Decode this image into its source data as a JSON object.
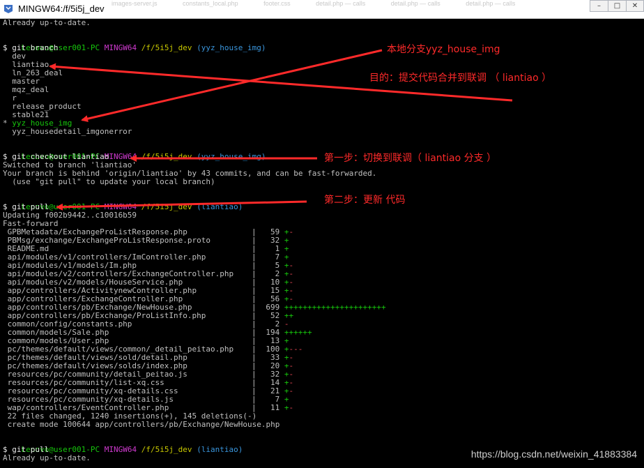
{
  "window": {
    "title": "MINGW64:/f/5i5j_dev",
    "ghost_tabs": [
      "images-server.js",
      "constants_local.php",
      "footer.css",
      "detail.php — calls",
      "detail.php — calls",
      "detail.php — calls"
    ]
  },
  "prompt": {
    "user": "Lenovo@user001-PC",
    "shell": "MINGW64",
    "path": "/f/5i5j_dev"
  },
  "terminal": {
    "line01": "Already up-to-date.",
    "prompt1_branch": "(yyz_house_img)",
    "cmd1": "$ git branch",
    "branches": [
      "  dev",
      "  liantiao",
      "  ln_263_deal",
      "  master",
      "  mqz_deal",
      "  r",
      "  release_product",
      "  stable21"
    ],
    "current_branch_mark": "* ",
    "current_branch": "yyz_house_img",
    "branch_last": "  yyz_housedetail_imgonerror",
    "prompt2_branch": "(yyz_house_img)",
    "cmd2": "$ git checkout liantiao",
    "switched": "Switched to branch 'liantiao'",
    "behind": "Your branch is behind 'origin/liantiao' by 43 commits, and can be fast-forwarded.",
    "hint": "  (use \"git pull\" to update your local branch)",
    "prompt3_branch": "(liantiao)",
    "cmd3": "$ git pull",
    "updating": "Updating f002b9442..c10016b59",
    "fastforward": "Fast-forward",
    "files": [
      {
        "name": " GPBMetadata/ExchangeProListResponse.php",
        "count": "59",
        "plus": "+",
        "minus": "-"
      },
      {
        "name": " PBMsg/exchange/ExchangeProListResponse.proto",
        "count": "32",
        "plus": "+",
        "minus": ""
      },
      {
        "name": " README.md",
        "count": "1",
        "plus": "+",
        "minus": ""
      },
      {
        "name": " api/modules/v1/controllers/ImController.php",
        "count": "7",
        "plus": "+",
        "minus": ""
      },
      {
        "name": " api/modules/v1/models/Im.php",
        "count": "5",
        "plus": "+",
        "minus": "-"
      },
      {
        "name": " api/modules/v2/controllers/ExchangeController.php",
        "count": "2",
        "plus": "+",
        "minus": "-"
      },
      {
        "name": " api/modules/v2/models/HouseService.php",
        "count": "10",
        "plus": "+",
        "minus": "-"
      },
      {
        "name": " app/controllers/ActivitynewController.php",
        "count": "15",
        "plus": "+",
        "minus": "-"
      },
      {
        "name": " app/controllers/ExchangeController.php",
        "count": "56",
        "plus": "+",
        "minus": "-"
      },
      {
        "name": " app/controllers/pb/Exchange/NewHouse.php",
        "count": "699",
        "plus": "++++++++++++++++++++++",
        "minus": ""
      },
      {
        "name": " app/controllers/pb/Exchange/ProListInfo.php",
        "count": "52",
        "plus": "++",
        "minus": ""
      },
      {
        "name": " common/config/constants.php",
        "count": "2",
        "plus": "",
        "minus": "-"
      },
      {
        "name": " common/models/Sale.php",
        "count": "194",
        "plus": "++++++",
        "minus": ""
      },
      {
        "name": " common/models/User.php",
        "count": "13",
        "plus": "+",
        "minus": ""
      },
      {
        "name": " pc/themes/default/views/common/_detail_peitao.php",
        "count": "100",
        "plus": "+",
        "minus": "---"
      },
      {
        "name": " pc/themes/default/views/sold/detail.php",
        "count": "33",
        "plus": "+",
        "minus": "-"
      },
      {
        "name": " pc/themes/default/views/solds/index.php",
        "count": "20",
        "plus": "+",
        "minus": "-"
      },
      {
        "name": " resources/pc/community/detail_peitao.js",
        "count": "32",
        "plus": "+",
        "minus": "-"
      },
      {
        "name": " resources/pc/community/list-xq.css",
        "count": "14",
        "plus": "+",
        "minus": "-"
      },
      {
        "name": " resources/pc/community/xq-details.css",
        "count": "21",
        "plus": "+",
        "minus": "-"
      },
      {
        "name": " resources/pc/community/xq-details.js",
        "count": "7",
        "plus": "+",
        "minus": ""
      },
      {
        "name": " wap/controllers/EventController.php",
        "count": "11",
        "plus": "+",
        "minus": "-"
      }
    ],
    "summary": " 22 files changed, 1240 insertions(+), 145 deletions(-)",
    "create_mode": " create mode 100644 app/controllers/pb/Exchange/NewHouse.php",
    "prompt4_branch": "(liantiao)",
    "cmd4": "$ git pull",
    "line_last": "Already up-to-date."
  },
  "annotations": {
    "a1": "本地分支yyz_house_img",
    "a2": "目的：提交代码合并到联调 （ liantiao ）",
    "a3": "第一步：切换到联调（ liantiao 分支 ）",
    "a4": "第二步：更新 代码"
  },
  "watermark": "https://blog.csdn.net/weixin_41883384",
  "colors": {
    "annotation": "#ff2a2a",
    "prompt_user": "#16c60c",
    "prompt_shell": "#d03ad0",
    "prompt_path": "#c8c800",
    "prompt_branch": "#3a96dd",
    "diff_plus": "#16c60c",
    "diff_minus": "#e74856"
  }
}
